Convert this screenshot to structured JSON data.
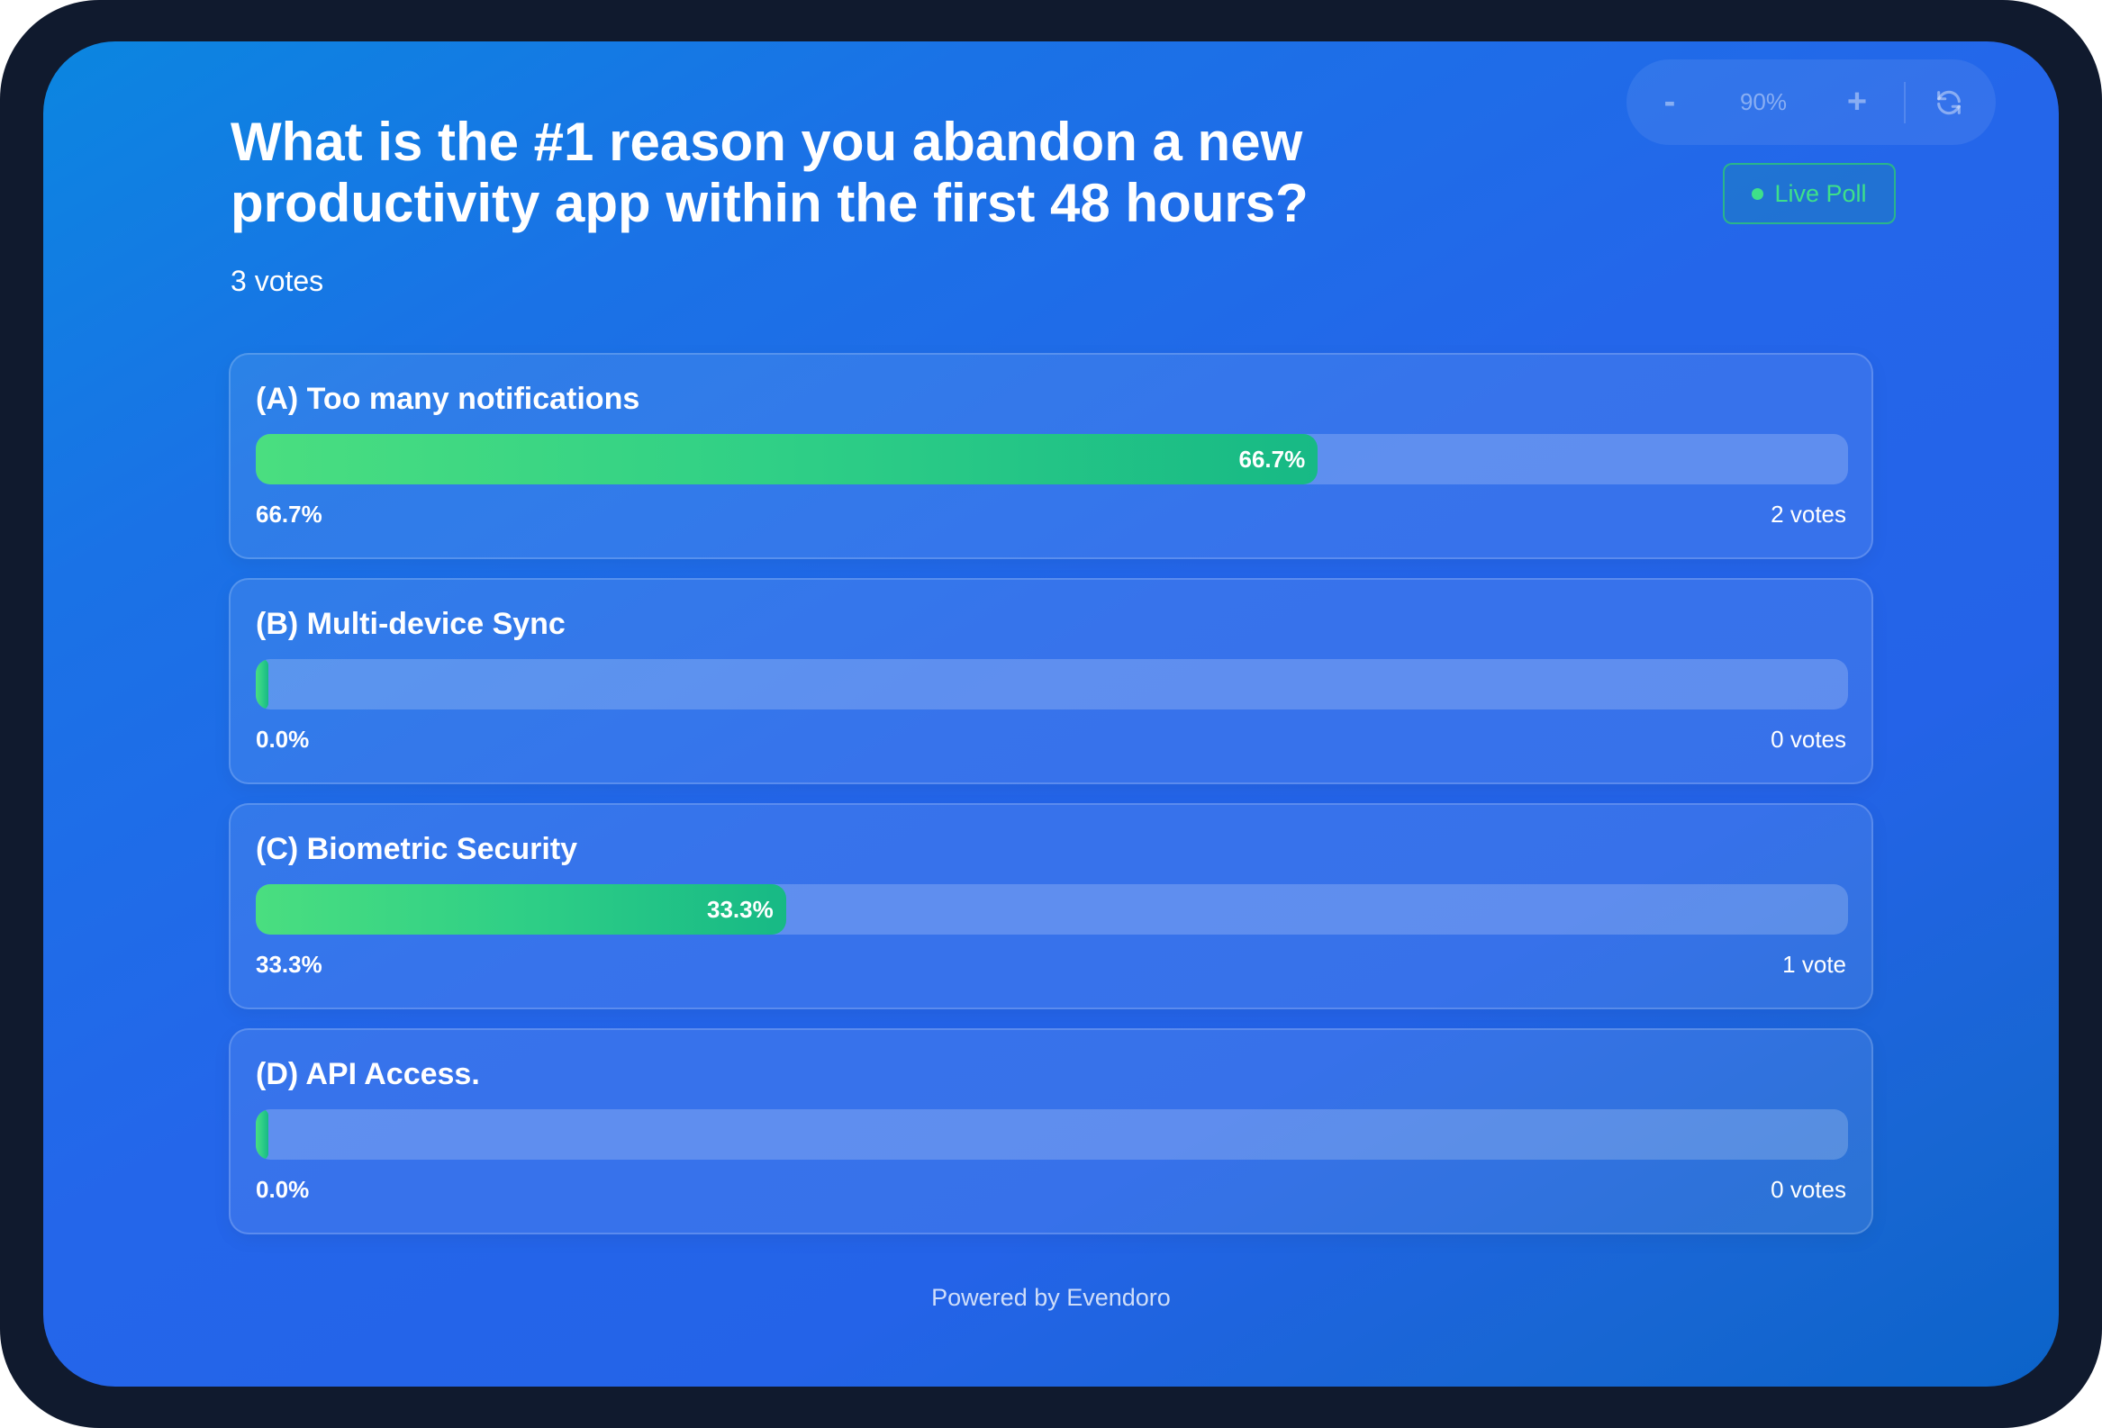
{
  "poll": {
    "question": "What is the #1 reason you abandon a new productivity app within the first 48 hours?",
    "total_votes": "3 votes",
    "live_badge": "Live Poll",
    "footer": "Powered by Evendoro"
  },
  "controls": {
    "zoom_out": "-",
    "zoom_level": "90%",
    "zoom_in": "+",
    "refresh_icon": "refresh-icon"
  },
  "options": [
    {
      "label": "(A) Too many notifications",
      "fraction": 0.667,
      "bar_label": "66.7%",
      "percent": "66.7%",
      "votes": "2 votes"
    },
    {
      "label": "(B) Multi-device Sync",
      "fraction": 0.0,
      "bar_label": "",
      "percent": "0.0%",
      "votes": "0 votes"
    },
    {
      "label": "(C) Biometric Security",
      "fraction": 0.333,
      "bar_label": "33.3%",
      "percent": "33.3%",
      "votes": "1 vote"
    },
    {
      "label": "(D) API Access.",
      "fraction": 0.0,
      "bar_label": "",
      "percent": "0.0%",
      "votes": "0 votes"
    }
  ],
  "colors": {
    "bar_start": "#4ade80",
    "bar_end": "#17b985",
    "live_green": "#3ee08a",
    "background": "#2466ea"
  }
}
